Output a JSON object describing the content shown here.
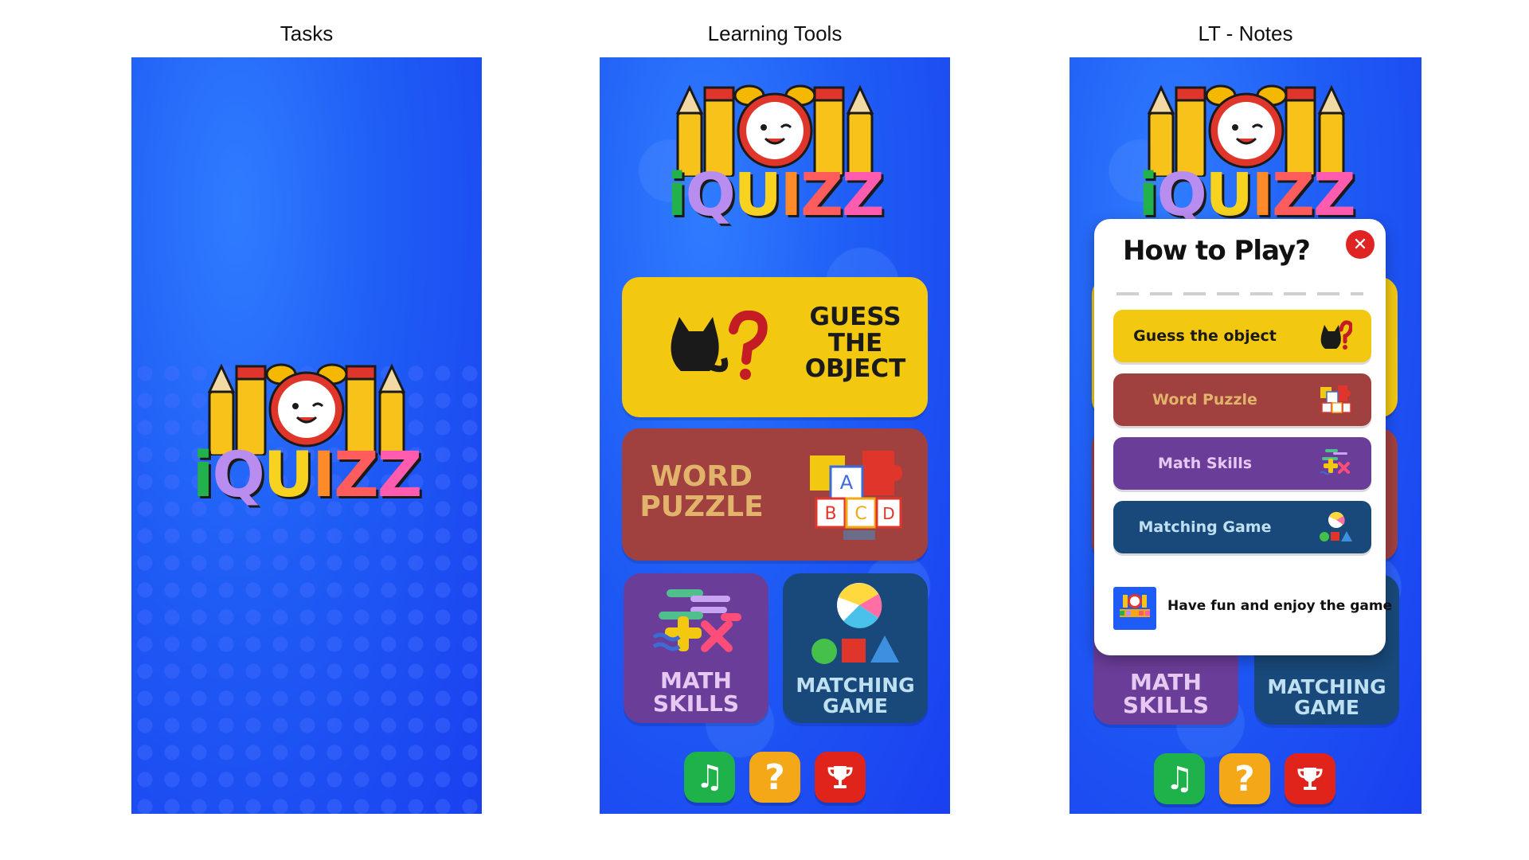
{
  "captions": {
    "screen1": "Tasks",
    "screen2": "Learning Tools",
    "screen3": "LT - Notes"
  },
  "logo": {
    "letters": [
      "i",
      "Q",
      "U",
      "I",
      "Z",
      "Z"
    ]
  },
  "menu": {
    "guess": "GUESS\nTHE\nOBJECT",
    "word": "WORD\nPUZZLE",
    "math": "MATH\nSKILLS",
    "matching": "MATCHING\nGAME"
  },
  "bottom_bar": {
    "music_icon": "♫",
    "help_icon": "?",
    "trophy_icon": "trophy-icon"
  },
  "modal": {
    "title": "How to Play?",
    "close_icon": "✕",
    "items": [
      {
        "label": "Guess the object",
        "color": "#f2c811",
        "text_color": "#1a1a1a"
      },
      {
        "label": "Word Puzzle",
        "color": "#a0413f",
        "text_color": "#e2b36a"
      },
      {
        "label": "Math Skills",
        "color": "#6a3d98",
        "text_color": "#e6c9f2"
      },
      {
        "label": "Matching Game",
        "color": "#18497a",
        "text_color": "#bfe0f0"
      }
    ],
    "footer_text": "Have fun and enjoy the game"
  },
  "colors": {
    "guess_card": "#f2c811",
    "word_card": "#a0413f",
    "math_card": "#6a3d98",
    "matching_card": "#18497a",
    "music_btn": "#1fb24a",
    "help_btn": "#f5a817",
    "trophy_btn": "#e0241c"
  }
}
